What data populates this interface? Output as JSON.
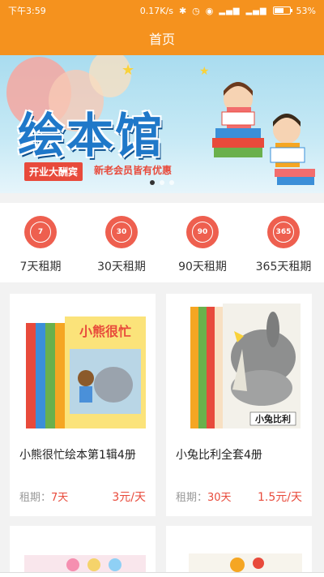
{
  "status": {
    "time": "下午3:59",
    "speed": "0.17K/s",
    "battery": "53%"
  },
  "appbar": {
    "title": "首页"
  },
  "banner": {
    "title": "绘本馆",
    "tag": "开业大酬宾",
    "subtitle": "新老会员皆有优惠"
  },
  "periods": [
    {
      "days": "7",
      "label": "7天租期"
    },
    {
      "days": "30",
      "label": "30天租期"
    },
    {
      "days": "90",
      "label": "90天租期"
    },
    {
      "days": "365",
      "label": "365天租期"
    }
  ],
  "products": [
    {
      "title": "小熊很忙绘本第1辑4册",
      "rent_label": "租期：",
      "rent_value": "7天",
      "price": "3元/天",
      "cover_text": "小熊很忙"
    },
    {
      "title": "小兔比利全套4册",
      "rent_label": "租期：",
      "rent_value": "30天",
      "price": "1.5元/天",
      "cover_text": "小兔比利"
    }
  ],
  "colors": {
    "primary": "#f5921e",
    "accent_red": "#e84a3b",
    "period_circle": "#ee5f4f"
  }
}
